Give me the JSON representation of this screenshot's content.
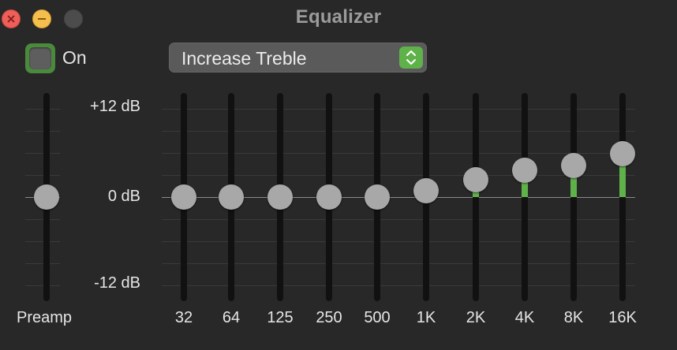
{
  "window": {
    "title": "Equalizer"
  },
  "toggle": {
    "label": "On",
    "checked": true
  },
  "preset": {
    "selected": "Increase Treble",
    "icon": "up-down-chevron-icon"
  },
  "scale": {
    "top_label": "+12 dB",
    "mid_label": "0 dB",
    "bottom_label": "-12 dB",
    "max_db": 12,
    "min_db": -12
  },
  "preamp": {
    "label": "Preamp",
    "gain_db": 0
  },
  "bands": [
    {
      "label": "32",
      "gain_db": 0
    },
    {
      "label": "64",
      "gain_db": 0
    },
    {
      "label": "125",
      "gain_db": 0
    },
    {
      "label": "250",
      "gain_db": 0
    },
    {
      "label": "500",
      "gain_db": 0
    },
    {
      "label": "1K",
      "gain_db": 0.9
    },
    {
      "label": "2K",
      "gain_db": 2.4
    },
    {
      "label": "4K",
      "gain_db": 3.6
    },
    {
      "label": "8K",
      "gain_db": 4.3
    },
    {
      "label": "16K",
      "gain_db": 5.9
    }
  ],
  "colors": {
    "accent": "#5fb24a",
    "close": "#ed5f58",
    "minimize": "#f5bf4f",
    "zoom_disabled": "#4c4c4c"
  }
}
